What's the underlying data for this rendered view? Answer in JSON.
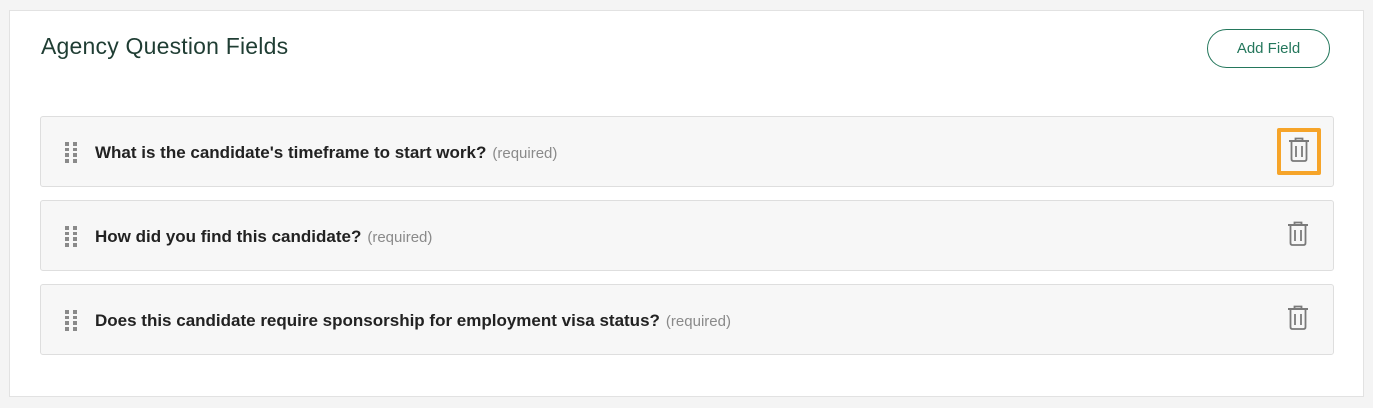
{
  "panel": {
    "title": "Agency Question Fields",
    "add_button_label": "Add Field"
  },
  "fields": [
    {
      "question": "What is the candidate's timeframe to start work?",
      "required_label": "(required)",
      "delete_highlighted": true
    },
    {
      "question": "How did you find this candidate?",
      "required_label": "(required)",
      "delete_highlighted": false
    },
    {
      "question": "Does this candidate require sponsorship for employment visa status?",
      "required_label": "(required)",
      "delete_highlighted": false
    }
  ],
  "icons": {
    "drag": "drag-handle-icon",
    "delete": "trash-icon"
  },
  "colors": {
    "accent": "#24775c",
    "title": "#1f3d33",
    "highlight": "#f6a429",
    "icon_gray": "#7a7a7a"
  }
}
